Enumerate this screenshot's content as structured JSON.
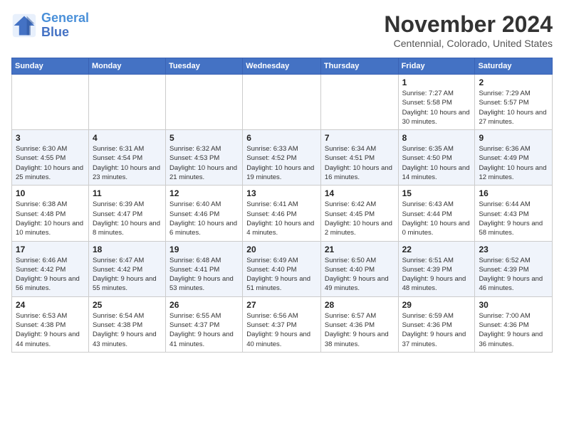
{
  "header": {
    "logo_line1": "General",
    "logo_line2": "Blue",
    "month": "November 2024",
    "location": "Centennial, Colorado, United States"
  },
  "weekdays": [
    "Sunday",
    "Monday",
    "Tuesday",
    "Wednesday",
    "Thursday",
    "Friday",
    "Saturday"
  ],
  "weeks": [
    [
      {
        "day": "",
        "info": ""
      },
      {
        "day": "",
        "info": ""
      },
      {
        "day": "",
        "info": ""
      },
      {
        "day": "",
        "info": ""
      },
      {
        "day": "",
        "info": ""
      },
      {
        "day": "1",
        "info": "Sunrise: 7:27 AM\nSunset: 5:58 PM\nDaylight: 10 hours and 30 minutes."
      },
      {
        "day": "2",
        "info": "Sunrise: 7:29 AM\nSunset: 5:57 PM\nDaylight: 10 hours and 27 minutes."
      }
    ],
    [
      {
        "day": "3",
        "info": "Sunrise: 6:30 AM\nSunset: 4:55 PM\nDaylight: 10 hours and 25 minutes."
      },
      {
        "day": "4",
        "info": "Sunrise: 6:31 AM\nSunset: 4:54 PM\nDaylight: 10 hours and 23 minutes."
      },
      {
        "day": "5",
        "info": "Sunrise: 6:32 AM\nSunset: 4:53 PM\nDaylight: 10 hours and 21 minutes."
      },
      {
        "day": "6",
        "info": "Sunrise: 6:33 AM\nSunset: 4:52 PM\nDaylight: 10 hours and 19 minutes."
      },
      {
        "day": "7",
        "info": "Sunrise: 6:34 AM\nSunset: 4:51 PM\nDaylight: 10 hours and 16 minutes."
      },
      {
        "day": "8",
        "info": "Sunrise: 6:35 AM\nSunset: 4:50 PM\nDaylight: 10 hours and 14 minutes."
      },
      {
        "day": "9",
        "info": "Sunrise: 6:36 AM\nSunset: 4:49 PM\nDaylight: 10 hours and 12 minutes."
      }
    ],
    [
      {
        "day": "10",
        "info": "Sunrise: 6:38 AM\nSunset: 4:48 PM\nDaylight: 10 hours and 10 minutes."
      },
      {
        "day": "11",
        "info": "Sunrise: 6:39 AM\nSunset: 4:47 PM\nDaylight: 10 hours and 8 minutes."
      },
      {
        "day": "12",
        "info": "Sunrise: 6:40 AM\nSunset: 4:46 PM\nDaylight: 10 hours and 6 minutes."
      },
      {
        "day": "13",
        "info": "Sunrise: 6:41 AM\nSunset: 4:46 PM\nDaylight: 10 hours and 4 minutes."
      },
      {
        "day": "14",
        "info": "Sunrise: 6:42 AM\nSunset: 4:45 PM\nDaylight: 10 hours and 2 minutes."
      },
      {
        "day": "15",
        "info": "Sunrise: 6:43 AM\nSunset: 4:44 PM\nDaylight: 10 hours and 0 minutes."
      },
      {
        "day": "16",
        "info": "Sunrise: 6:44 AM\nSunset: 4:43 PM\nDaylight: 9 hours and 58 minutes."
      }
    ],
    [
      {
        "day": "17",
        "info": "Sunrise: 6:46 AM\nSunset: 4:42 PM\nDaylight: 9 hours and 56 minutes."
      },
      {
        "day": "18",
        "info": "Sunrise: 6:47 AM\nSunset: 4:42 PM\nDaylight: 9 hours and 55 minutes."
      },
      {
        "day": "19",
        "info": "Sunrise: 6:48 AM\nSunset: 4:41 PM\nDaylight: 9 hours and 53 minutes."
      },
      {
        "day": "20",
        "info": "Sunrise: 6:49 AM\nSunset: 4:40 PM\nDaylight: 9 hours and 51 minutes."
      },
      {
        "day": "21",
        "info": "Sunrise: 6:50 AM\nSunset: 4:40 PM\nDaylight: 9 hours and 49 minutes."
      },
      {
        "day": "22",
        "info": "Sunrise: 6:51 AM\nSunset: 4:39 PM\nDaylight: 9 hours and 48 minutes."
      },
      {
        "day": "23",
        "info": "Sunrise: 6:52 AM\nSunset: 4:39 PM\nDaylight: 9 hours and 46 minutes."
      }
    ],
    [
      {
        "day": "24",
        "info": "Sunrise: 6:53 AM\nSunset: 4:38 PM\nDaylight: 9 hours and 44 minutes."
      },
      {
        "day": "25",
        "info": "Sunrise: 6:54 AM\nSunset: 4:38 PM\nDaylight: 9 hours and 43 minutes."
      },
      {
        "day": "26",
        "info": "Sunrise: 6:55 AM\nSunset: 4:37 PM\nDaylight: 9 hours and 41 minutes."
      },
      {
        "day": "27",
        "info": "Sunrise: 6:56 AM\nSunset: 4:37 PM\nDaylight: 9 hours and 40 minutes."
      },
      {
        "day": "28",
        "info": "Sunrise: 6:57 AM\nSunset: 4:36 PM\nDaylight: 9 hours and 38 minutes."
      },
      {
        "day": "29",
        "info": "Sunrise: 6:59 AM\nSunset: 4:36 PM\nDaylight: 9 hours and 37 minutes."
      },
      {
        "day": "30",
        "info": "Sunrise: 7:00 AM\nSunset: 4:36 PM\nDaylight: 9 hours and 36 minutes."
      }
    ]
  ]
}
